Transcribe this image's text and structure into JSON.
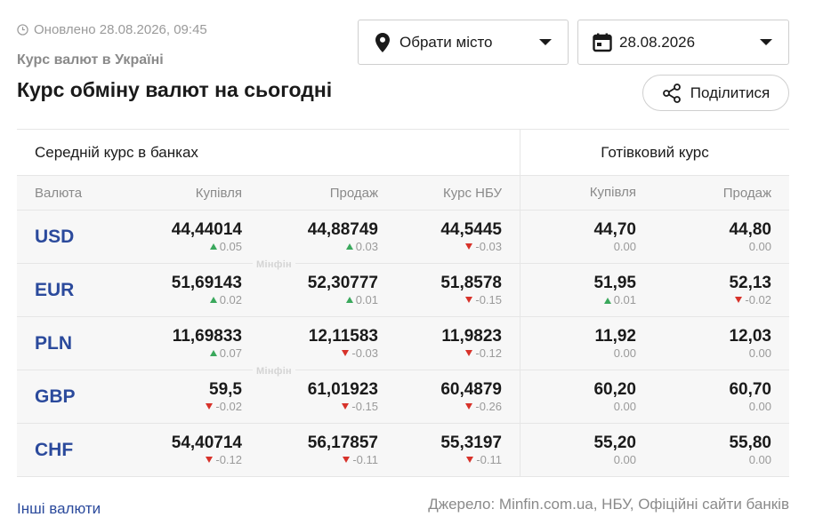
{
  "header": {
    "updated": "Оновлено 28.08.2026, 09:45",
    "subtitle": "Курс валют в Україні",
    "title": "Курс обміну валют на сьогодні"
  },
  "controls": {
    "city_label": "Обрати місто",
    "date_label": "28.08.2026",
    "share_label": "Поділитися"
  },
  "table": {
    "group_bank": "Середній курс в банках",
    "group_cash": "Готівковий курс",
    "columns": [
      "Валюта",
      "Купівля",
      "Продаж",
      "Курс НБУ",
      "Купівля",
      "Продаж"
    ],
    "watermark": "Мінфін",
    "rows": [
      {
        "currency": "USD",
        "buy": "44,44014",
        "buy_d": "0.05",
        "buy_dir": "up",
        "sell": "44,88749",
        "sell_d": "0.03",
        "sell_dir": "up",
        "nbu": "44,5445",
        "nbu_d": "-0.03",
        "nbu_dir": "down",
        "cbuy": "44,70",
        "cbuy_d": "0.00",
        "cbuy_dir": "none",
        "csell": "44,80",
        "csell_d": "0.00",
        "csell_dir": "none"
      },
      {
        "currency": "EUR",
        "buy": "51,69143",
        "buy_d": "0.02",
        "buy_dir": "up",
        "sell": "52,30777",
        "sell_d": "0.01",
        "sell_dir": "up",
        "nbu": "51,8578",
        "nbu_d": "-0.15",
        "nbu_dir": "down",
        "cbuy": "51,95",
        "cbuy_d": "0.01",
        "cbuy_dir": "up",
        "csell": "52,13",
        "csell_d": "-0.02",
        "csell_dir": "down"
      },
      {
        "currency": "PLN",
        "buy": "11,69833",
        "buy_d": "0.07",
        "buy_dir": "up",
        "sell": "12,11583",
        "sell_d": "-0.03",
        "sell_dir": "down",
        "nbu": "11,9823",
        "nbu_d": "-0.12",
        "nbu_dir": "down",
        "cbuy": "11,92",
        "cbuy_d": "0.00",
        "cbuy_dir": "none",
        "csell": "12,03",
        "csell_d": "0.00",
        "csell_dir": "none"
      },
      {
        "currency": "GBP",
        "buy": "59,5",
        "buy_d": "-0.02",
        "buy_dir": "down",
        "sell": "61,01923",
        "sell_d": "-0.15",
        "sell_dir": "down",
        "nbu": "60,4879",
        "nbu_d": "-0.26",
        "nbu_dir": "down",
        "cbuy": "60,20",
        "cbuy_d": "0.00",
        "cbuy_dir": "none",
        "csell": "60,70",
        "csell_d": "0.00",
        "csell_dir": "none"
      },
      {
        "currency": "CHF",
        "buy": "54,40714",
        "buy_d": "-0.12",
        "buy_dir": "down",
        "sell": "56,17857",
        "sell_d": "-0.11",
        "sell_dir": "down",
        "nbu": "55,3197",
        "nbu_d": "-0.11",
        "nbu_dir": "down",
        "cbuy": "55,20",
        "cbuy_d": "0.00",
        "cbuy_dir": "none",
        "csell": "55,80",
        "csell_d": "0.00",
        "csell_dir": "none"
      }
    ]
  },
  "footer": {
    "other_link": "Інші валюти",
    "source": "Джерело: Minfin.com.ua, НБУ, Офіційні сайти банків"
  },
  "icons": {
    "clock": "clock-icon",
    "location": "location-pin-icon",
    "calendar": "calendar-icon",
    "share": "share-icon",
    "dropdown": "caret-down-icon"
  },
  "colors": {
    "link": "#2b4a9c",
    "up": "#3aa85c",
    "down": "#d7322a"
  }
}
